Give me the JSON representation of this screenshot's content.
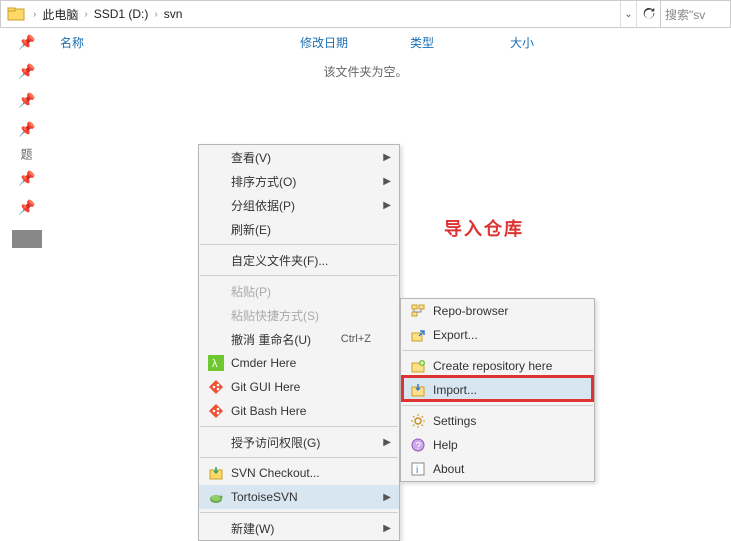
{
  "breadcrumb": {
    "root": "此电脑",
    "drive": "SSD1 (D:)",
    "folder": "svn"
  },
  "search": {
    "placeholder": "搜索\"sv"
  },
  "columns": {
    "name": "名称",
    "date": "修改日期",
    "type": "类型",
    "size": "大小"
  },
  "empty_message": "该文件夹为空。",
  "sidebar_label": "题",
  "annotation": "导入仓库",
  "context_menu": {
    "view": "查看(V)",
    "sort": "排序方式(O)",
    "group": "分组依据(P)",
    "refresh": "刷新(E)",
    "customize": "自定义文件夹(F)...",
    "paste": "粘贴(P)",
    "paste_shortcut": "粘贴快捷方式(S)",
    "undo": "撤消 重命名(U)",
    "undo_key": "Ctrl+Z",
    "cmder": "Cmder Here",
    "gitgui": "Git GUI Here",
    "gitbash": "Git Bash Here",
    "grant": "授予访问权限(G)",
    "svn_checkout": "SVN Checkout...",
    "tortoise": "TortoiseSVN",
    "new": "新建(W)"
  },
  "submenu": {
    "repo_browser": "Repo-browser",
    "export": "Export...",
    "create_repo": "Create repository here",
    "import": "Import...",
    "settings": "Settings",
    "help": "Help",
    "about": "About"
  }
}
